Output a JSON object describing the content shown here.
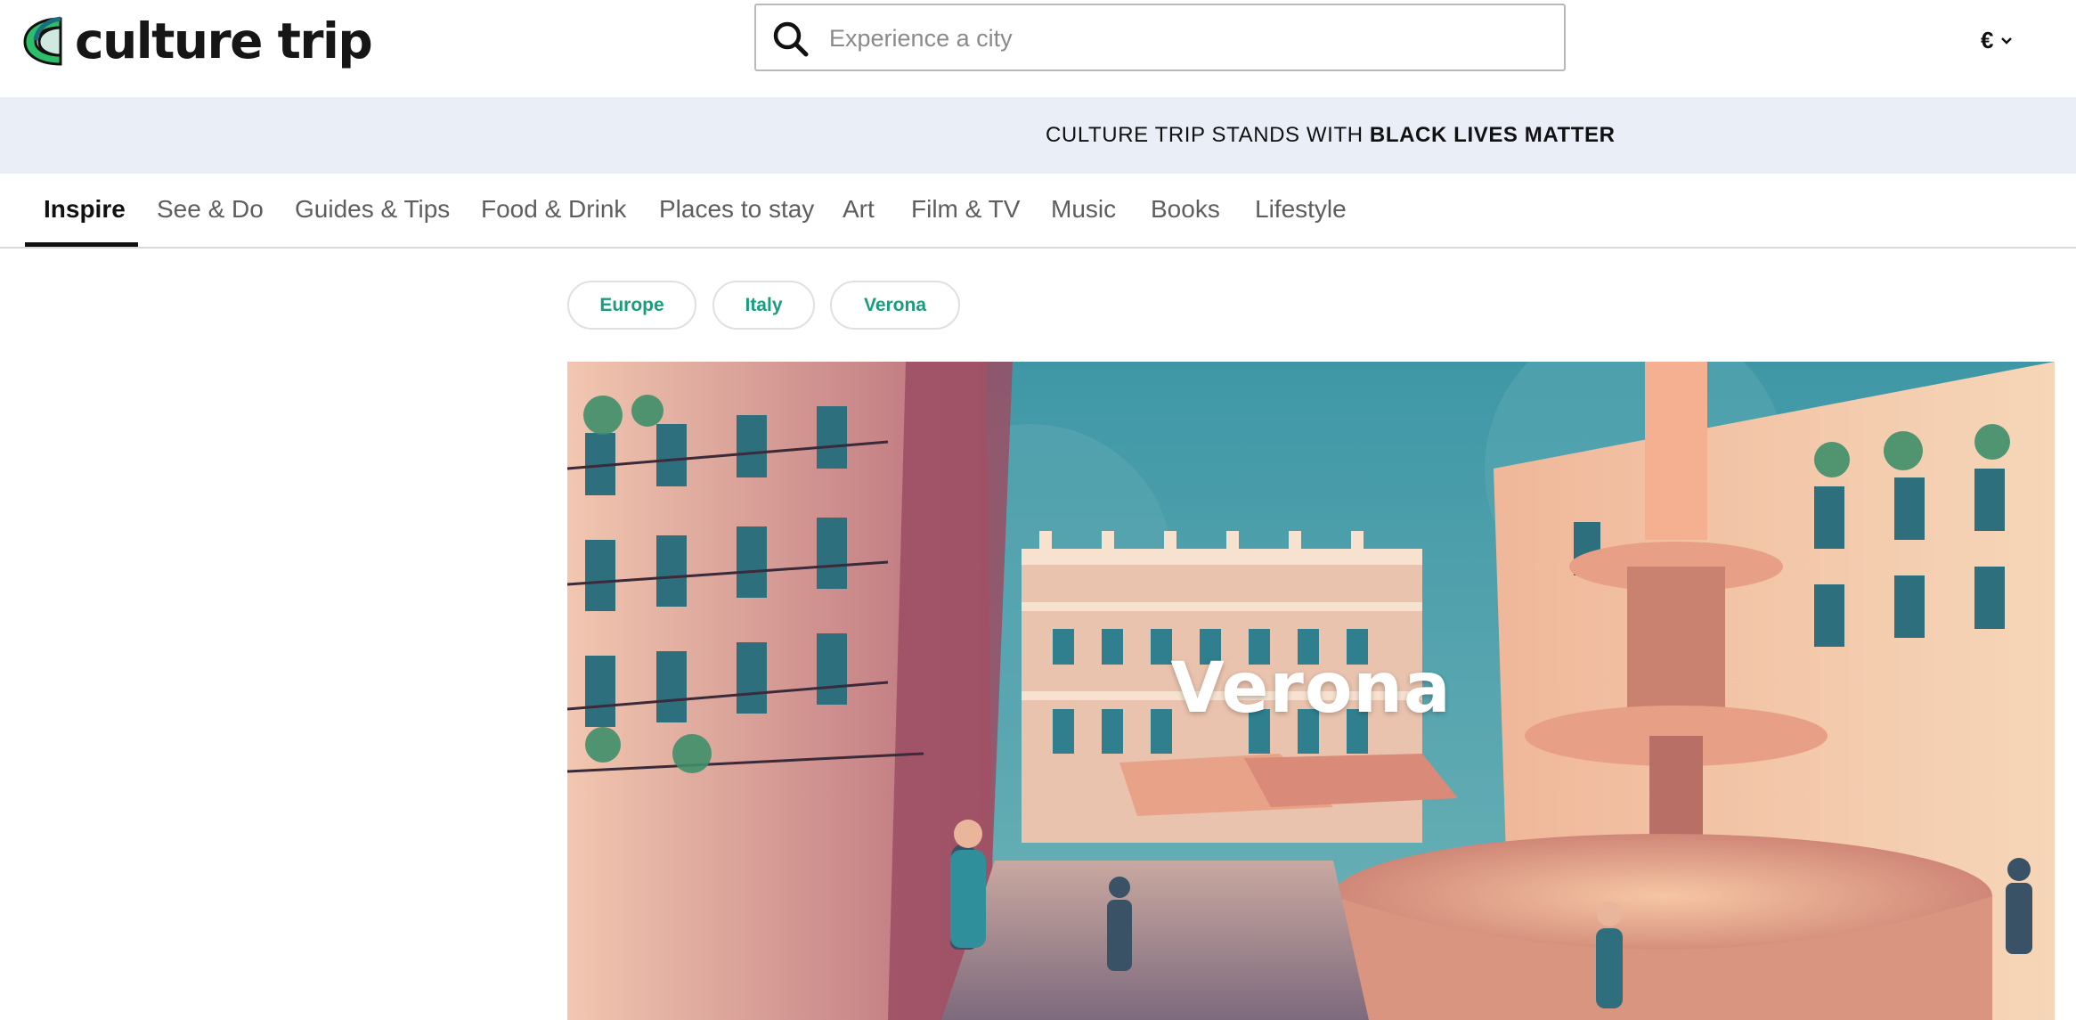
{
  "header": {
    "logo_text": "culture trip",
    "search": {
      "placeholder": "Experience a city",
      "value": ""
    },
    "currency": "€"
  },
  "banner": {
    "prefix": "CULTURE TRIP STANDS WITH ",
    "emphasis": "BLACK LIVES MATTER"
  },
  "nav": {
    "items": [
      {
        "label": "Inspire",
        "active": true
      },
      {
        "label": "See & Do"
      },
      {
        "label": "Guides & Tips"
      },
      {
        "label": "Food & Drink"
      },
      {
        "label": "Places to stay"
      },
      {
        "label": "Art"
      },
      {
        "label": "Film & TV"
      },
      {
        "label": "Music"
      },
      {
        "label": "Books"
      },
      {
        "label": "Lifestyle"
      }
    ]
  },
  "breadcrumbs": {
    "chips": [
      "Europe",
      "Italy",
      "Verona"
    ]
  },
  "hero": {
    "title": "Verona",
    "image": "illustrated-piazza-delle-erbe-verona"
  },
  "colors": {
    "accent": "#199d7d",
    "banner_bg": "#eaeff7",
    "logo_green": "#2bbf6a",
    "logo_teal": "#1a6e80"
  }
}
